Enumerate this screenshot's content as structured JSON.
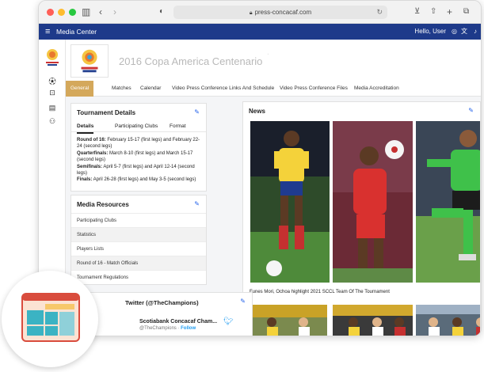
{
  "browser": {
    "url": "press-concacaf.com"
  },
  "appbar": {
    "title": "Media Center",
    "greeting": "Hello, User"
  },
  "tournament": {
    "title": "2016 Copa America Centenario"
  },
  "tabs": [
    {
      "label": "General",
      "active": true
    },
    {
      "label": "Matches"
    },
    {
      "label": "Calendar"
    },
    {
      "label": "Video Press Conference Links And Schedule"
    },
    {
      "label": "Video Press Conference Files"
    },
    {
      "label": "Media Accreditation"
    }
  ],
  "tournament_details": {
    "title": "Tournament Details",
    "subtabs": [
      "Details",
      "Participating Clubs",
      "Format"
    ],
    "lines": [
      {
        "label": "Round of 16:",
        "text": " February 15-17 (first legs) and February 22-24 (second legs)"
      },
      {
        "label": "Quarterfinals:",
        "text": " March 8-10 (first legs) and March 15-17 (second legs)"
      },
      {
        "label": "Semifinals:",
        "text": " April 5-7 (first legs) and April 12-14 (second legs)"
      },
      {
        "label": "Finals:",
        "text": " April 26-28 (first legs) and May 3-5 (second legs)"
      }
    ]
  },
  "media_resources": {
    "title": "Media Resources",
    "items": [
      "Participating Clubs",
      "Statistics",
      "Players Lists",
      "Round of 16 - Match Officials",
      "Tournament Regulations"
    ]
  },
  "twitter": {
    "title": "Twitter (@TheChampions)",
    "account_name": "Scotiabank Concacaf Cham...",
    "handle": "@TheChampions",
    "separator": " · ",
    "follow": "Follow"
  },
  "news": {
    "title": "News",
    "caption": "Funes Mori, Ochoa highlight 2021 SCCL Team Of The Tournament"
  },
  "icons": {
    "edit": "pencil-icon",
    "menu": "hamburger-icon",
    "twitter": "twitter-bird-icon"
  },
  "colors": {
    "appbar": "#1e3a8a",
    "active_tab": "#d4a85b",
    "link": "#2563eb"
  }
}
